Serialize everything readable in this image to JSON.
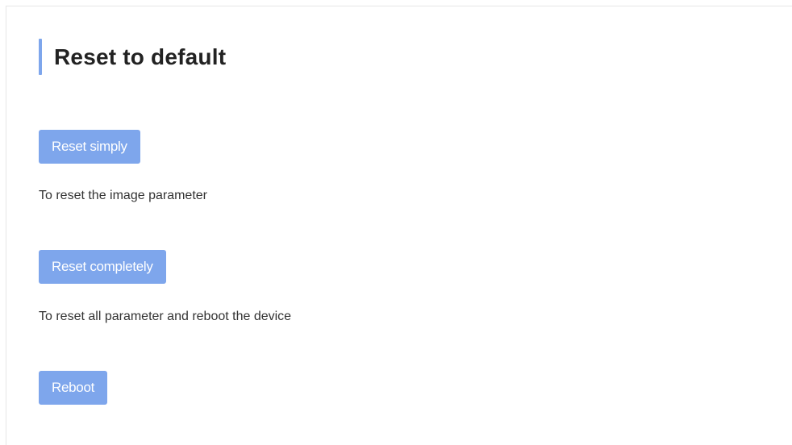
{
  "page": {
    "title": "Reset to default",
    "accent_color": "#7ea6ec"
  },
  "actions": [
    {
      "label": "Reset simply",
      "description": "To reset the image parameter"
    },
    {
      "label": "Reset completely",
      "description": "To reset all parameter and reboot the device"
    },
    {
      "label": "Reboot"
    }
  ]
}
